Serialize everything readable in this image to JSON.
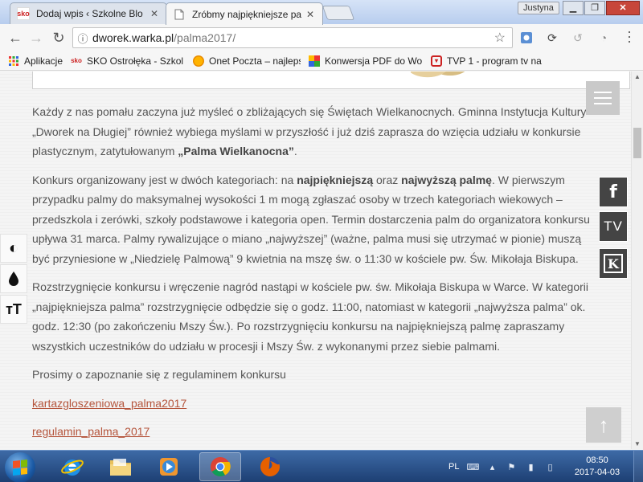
{
  "browser": {
    "tabs": [
      {
        "title": "Dodaj wpis ‹ Szkolne Blo",
        "favicon": "sko-icon",
        "active": false
      },
      {
        "title": "Zróbmy najpiękniejsze pa",
        "favicon": "page-icon",
        "active": true
      }
    ],
    "user": "Justyna",
    "url_host": "dworek.warka.pl",
    "url_path": "/palma2017/",
    "bookmarks": [
      {
        "label": "Aplikacje",
        "icon": "apps-grid-icon"
      },
      {
        "label": "SKO Ostrołęka - Szkol",
        "icon": "sko-icon"
      },
      {
        "label": "Onet Poczta – najleps",
        "icon": "onet-icon"
      },
      {
        "label": "Konwersja PDF do Wo",
        "icon": "pdf-convert-icon"
      },
      {
        "label": "TVP 1 - program tv na",
        "icon": "tvp-icon"
      }
    ]
  },
  "article": {
    "p1": {
      "text": "Każdy z nas pomału zaczyna już myśleć o zbliżających się Świętach Wielkanocnych. Gminna Instytucja Kultury „Dworek na Długiej” również wybiega myślami w przyszłość i już dziś zaprasza do wzięcia udziału w konkursie plastycznym, zatytułowanym ",
      "bold": "„Palma Wielkanocna”",
      "end": "."
    },
    "p2": {
      "t1": "Konkurs organizowany jest w dwóch kategoriach: na ",
      "b1": "najpiękniejszą",
      "t2": " oraz ",
      "b2": "najwyższą palmę",
      "t3": ". W pierwszym przypadku palmy do maksymalnej wysokości 1 m mogą zgłaszać osoby w trzech kategoriach wiekowych – przedszkola i zerówki, szkoły podstawowe i kategoria open. Termin dostarczenia palm do organizatora konkursu upływa 31 marca. Palmy rywalizujące o miano „najwyższej” (ważne, palma musi się utrzymać w pionie) muszą być przyniesione w „Niedzielę Palmową” 9 kwietnia na mszę św. o 11:30 w kościele pw. Św. Mikołaja Biskupa."
    },
    "p3": "Rozstrzygnięcie konkursu i wręczenie nagród nastąpi w kościele pw. św. Mikołaja Biskupa w Warce. W kategorii „najpiękniejsza palma” rozstrzygnięcie odbędzie się o godz. 11:00, natomiast w kategorii „najwyższa palma” ok. godz. 12:30 (po zakończeniu Mszy Św.). Po rozstrzygnięciu konkursu na najpiękniejszą palmę zapraszamy wszystkich uczestników do udziału w procesji i Mszy Św. z wykonanymi przez siebie palmami.",
    "p4": "Prosimy o zapoznanie się z regulaminem konkursu",
    "link1": "kartazgloszeniowa_palma2017",
    "link2": "regulamin_palma_2017"
  },
  "side": {
    "social": {
      "facebook": "f",
      "tv": "TV",
      "kw": "K"
    },
    "a11y": {
      "contrast": "◐",
      "ink": "💧",
      "textsize": "тT"
    }
  },
  "taskbar": {
    "lang": "PL",
    "time": "08:50",
    "date": "2017-04-03"
  },
  "colors": {
    "link": "#b5553c",
    "text": "#555555",
    "taskbar": "#2a5189"
  }
}
